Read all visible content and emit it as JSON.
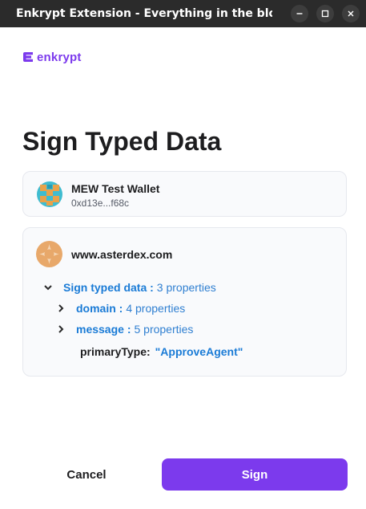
{
  "window": {
    "title": "Enkrypt Extension - Everything in the block...",
    "controls": [
      "minimize-icon",
      "maximize-icon",
      "close-icon"
    ]
  },
  "brand": {
    "name": "enkrypt",
    "accent_color": "#7c3aed"
  },
  "page": {
    "title": "Sign Typed Data"
  },
  "wallet": {
    "name": "MEW Test Wallet",
    "address": "0xd13e...f68c",
    "avatar_icon": "wallet-avatar-icon"
  },
  "site": {
    "domain": "www.asterdex.com",
    "icon": "asterdex-logo-icon"
  },
  "typed_data": {
    "root_key": "Sign typed data :",
    "root_meta": "3 properties",
    "items": [
      {
        "key": "domain :",
        "meta": "4 properties",
        "expanded": false
      },
      {
        "key": "message :",
        "meta": "5 properties",
        "expanded": false
      }
    ],
    "primary_type_key": "primaryType:",
    "primary_type_value": "\"ApproveAgent\""
  },
  "actions": {
    "cancel_label": "Cancel",
    "sign_label": "Sign"
  }
}
